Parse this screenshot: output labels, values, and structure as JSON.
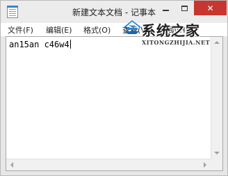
{
  "window": {
    "title": "新建文本文档 - 记事本",
    "buttons": {
      "minimize": "—",
      "maximize": "□",
      "close": "✕"
    }
  },
  "menu": {
    "items": [
      {
        "label": "文件(F)"
      },
      {
        "label": "编辑(E)"
      },
      {
        "label": "格式(O)"
      },
      {
        "label": "查看(V)"
      },
      {
        "label": "帮助(H)"
      }
    ]
  },
  "document": {
    "text": "an15an c46w4"
  },
  "watermark": {
    "brand": "系统之家",
    "url": "XITONGZHIJIA.NET"
  },
  "icons": {
    "app": "notepad-icon",
    "logo": "xitongzhijia-logo"
  },
  "colors": {
    "close_button": "#c7372f",
    "logo_blue": "#1e88e5",
    "title_bar": "#ececec"
  }
}
